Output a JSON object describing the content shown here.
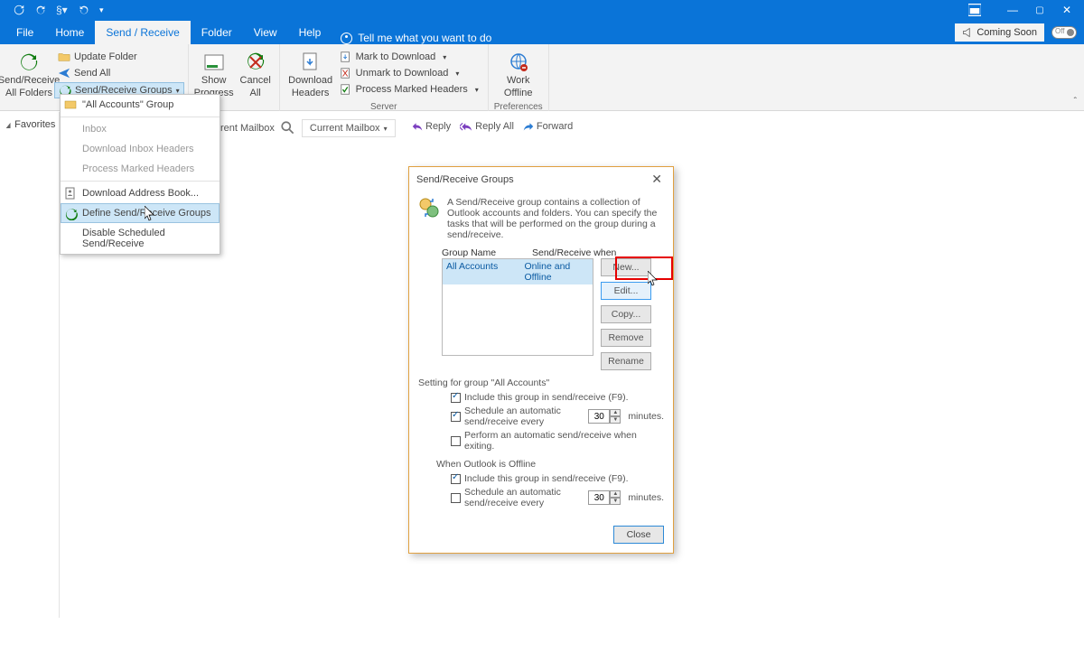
{
  "titlebar": {
    "window_buttons": {
      "min": "—",
      "restore": "▢",
      "close": "✕"
    }
  },
  "tabs": {
    "file": "File",
    "home": "Home",
    "send_receive": "Send / Receive",
    "folder": "Folder",
    "view": "View",
    "help": "Help",
    "tell_me": "Tell me what you want to do",
    "coming_soon": "Coming Soon",
    "toggle_state": "Off"
  },
  "ribbon": {
    "sr_all": {
      "line1": "Send/Receive",
      "line2": "All Folders"
    },
    "update_folder": "Update Folder",
    "send_all": "Send All",
    "sr_groups": "Send/Receive Groups",
    "show_progress": {
      "line1": "Show",
      "line2": "Progress"
    },
    "cancel_all": {
      "line1": "Cancel",
      "line2": "All"
    },
    "download_headers": {
      "line1": "Download",
      "line2": "Headers"
    },
    "mark_download": "Mark to Download",
    "unmark_download": "Unmark to Download",
    "process_marked": "Process Marked Headers",
    "work_offline": {
      "line1": "Work",
      "line2": "Offline"
    },
    "group_labels": {
      "server": "Server",
      "preferences": "Preferences"
    }
  },
  "dropdown": {
    "all_accounts_group": "\"All Accounts\" Group",
    "inbox": "Inbox",
    "download_inbox_headers": "Download Inbox Headers",
    "process_marked_headers": "Process Marked Headers",
    "download_address_book": "Download Address Book...",
    "define_groups": "Define Send/Receive Groups",
    "disable_scheduled": "Disable Scheduled Send/Receive"
  },
  "leftpane": {
    "favorites": "Favorites"
  },
  "searchrow": {
    "current_mailbox_text": "rent Mailbox",
    "scope": "Current Mailbox"
  },
  "replyrow": {
    "reply": "Reply",
    "reply_all": "Reply All",
    "forward": "Forward"
  },
  "dialog": {
    "title": "Send/Receive Groups",
    "description": "A Send/Receive group contains a collection of Outlook accounts and folders. You can specify the tasks that will be performed on the group during a send/receive.",
    "col_group_name": "Group Name",
    "col_when": "Send/Receive when",
    "row_name": "All Accounts",
    "row_when": "Online and Offline",
    "btn_new": "New...",
    "btn_edit": "Edit...",
    "btn_copy": "Copy...",
    "btn_remove": "Remove",
    "btn_rename": "Rename",
    "settings_header": "Setting for group \"All Accounts\"",
    "chk_include_online": "Include this group in send/receive (F9).",
    "chk_schedule_online": "Schedule an automatic send/receive every",
    "schedule_online_value": "30",
    "minutes": "minutes.",
    "chk_exit": "Perform an automatic send/receive when exiting.",
    "offline_header": "When Outlook is Offline",
    "chk_include_offline": "Include this group in send/receive (F9).",
    "chk_schedule_offline": "Schedule an automatic send/receive every",
    "schedule_offline_value": "30",
    "btn_close": "Close"
  }
}
